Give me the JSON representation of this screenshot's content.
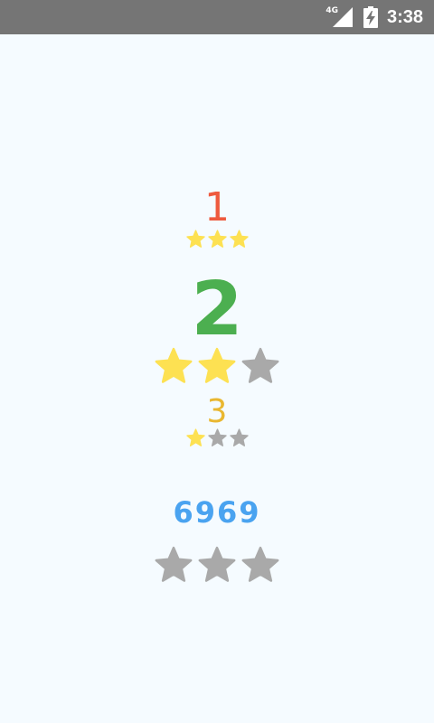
{
  "status_bar": {
    "network_type": "4G",
    "time": "3:38",
    "icons": [
      "signal-icon",
      "battery-charging-icon"
    ]
  },
  "colors": {
    "background": "#f5fbff",
    "status_bar": "#757575",
    "star_filled": "#fde152",
    "star_empty": "#a9a9a9",
    "score": "#4aa3f0"
  },
  "levels": [
    {
      "number": "1",
      "color": "#ee5a3e",
      "stars_earned": 3,
      "stars_total": 3
    },
    {
      "number": "2",
      "color": "#4caf50",
      "stars_earned": 2,
      "stars_total": 3
    },
    {
      "number": "3",
      "color": "#e9b730",
      "stars_earned": 1,
      "stars_total": 3
    }
  ],
  "score": {
    "value": "6969"
  },
  "final_rating": {
    "stars_earned": 0,
    "stars_total": 3
  }
}
